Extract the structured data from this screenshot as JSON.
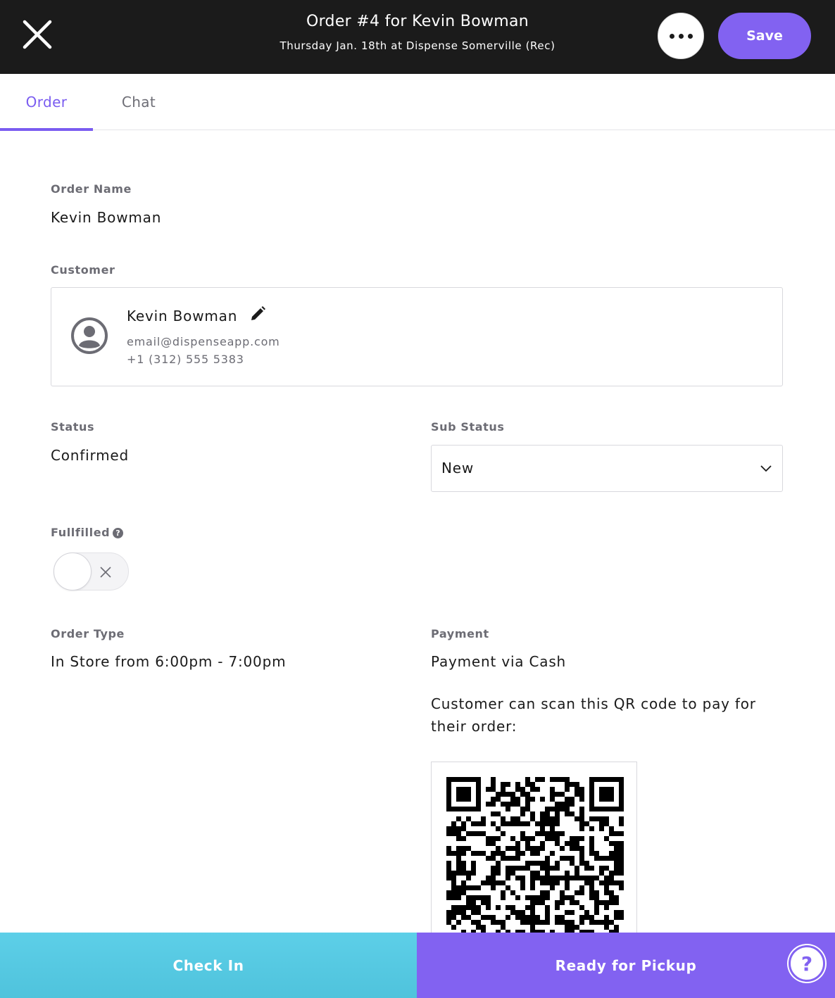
{
  "header": {
    "title": "Order #4 for Kevin Bowman",
    "subtitle": "Thursday Jan. 18th at Dispense Somerville (Rec)",
    "close_icon": "close-icon",
    "more_icon": "more-horizontal-icon",
    "save_label": "Save"
  },
  "tabs": [
    {
      "label": "Order",
      "active": true
    },
    {
      "label": "Chat",
      "active": false
    }
  ],
  "order_name": {
    "label": "Order Name",
    "value": "Kevin Bowman"
  },
  "customer": {
    "label": "Customer",
    "name": "Kevin Bowman",
    "email": "email@dispenseapp.com",
    "phone": "+1 (312) 555 5383",
    "avatar_icon": "user-avatar-icon",
    "edit_icon": "pencil-icon"
  },
  "status": {
    "label": "Status",
    "value": "Confirmed"
  },
  "sub_status": {
    "label": "Sub Status",
    "value": "New",
    "chevron_icon": "chevron-down-icon"
  },
  "fulfilled": {
    "label": "Fullfilled",
    "help_icon": "question-circle-icon",
    "help_glyph": "?",
    "checked": false
  },
  "order_type": {
    "label": "Order Type",
    "value": "In Store from 6:00pm - 7:00pm"
  },
  "payment": {
    "label": "Payment",
    "value": "Payment via Cash",
    "qr_text": "Customer can scan this QR code to pay for their order:"
  },
  "actions": {
    "check_in": "Check In",
    "ready_for_pickup": "Ready for Pickup",
    "help_glyph": "?"
  },
  "colors": {
    "header_bg": "#1b1b1b",
    "accent": "#8262f1",
    "check_in": "#5dcfe8"
  }
}
